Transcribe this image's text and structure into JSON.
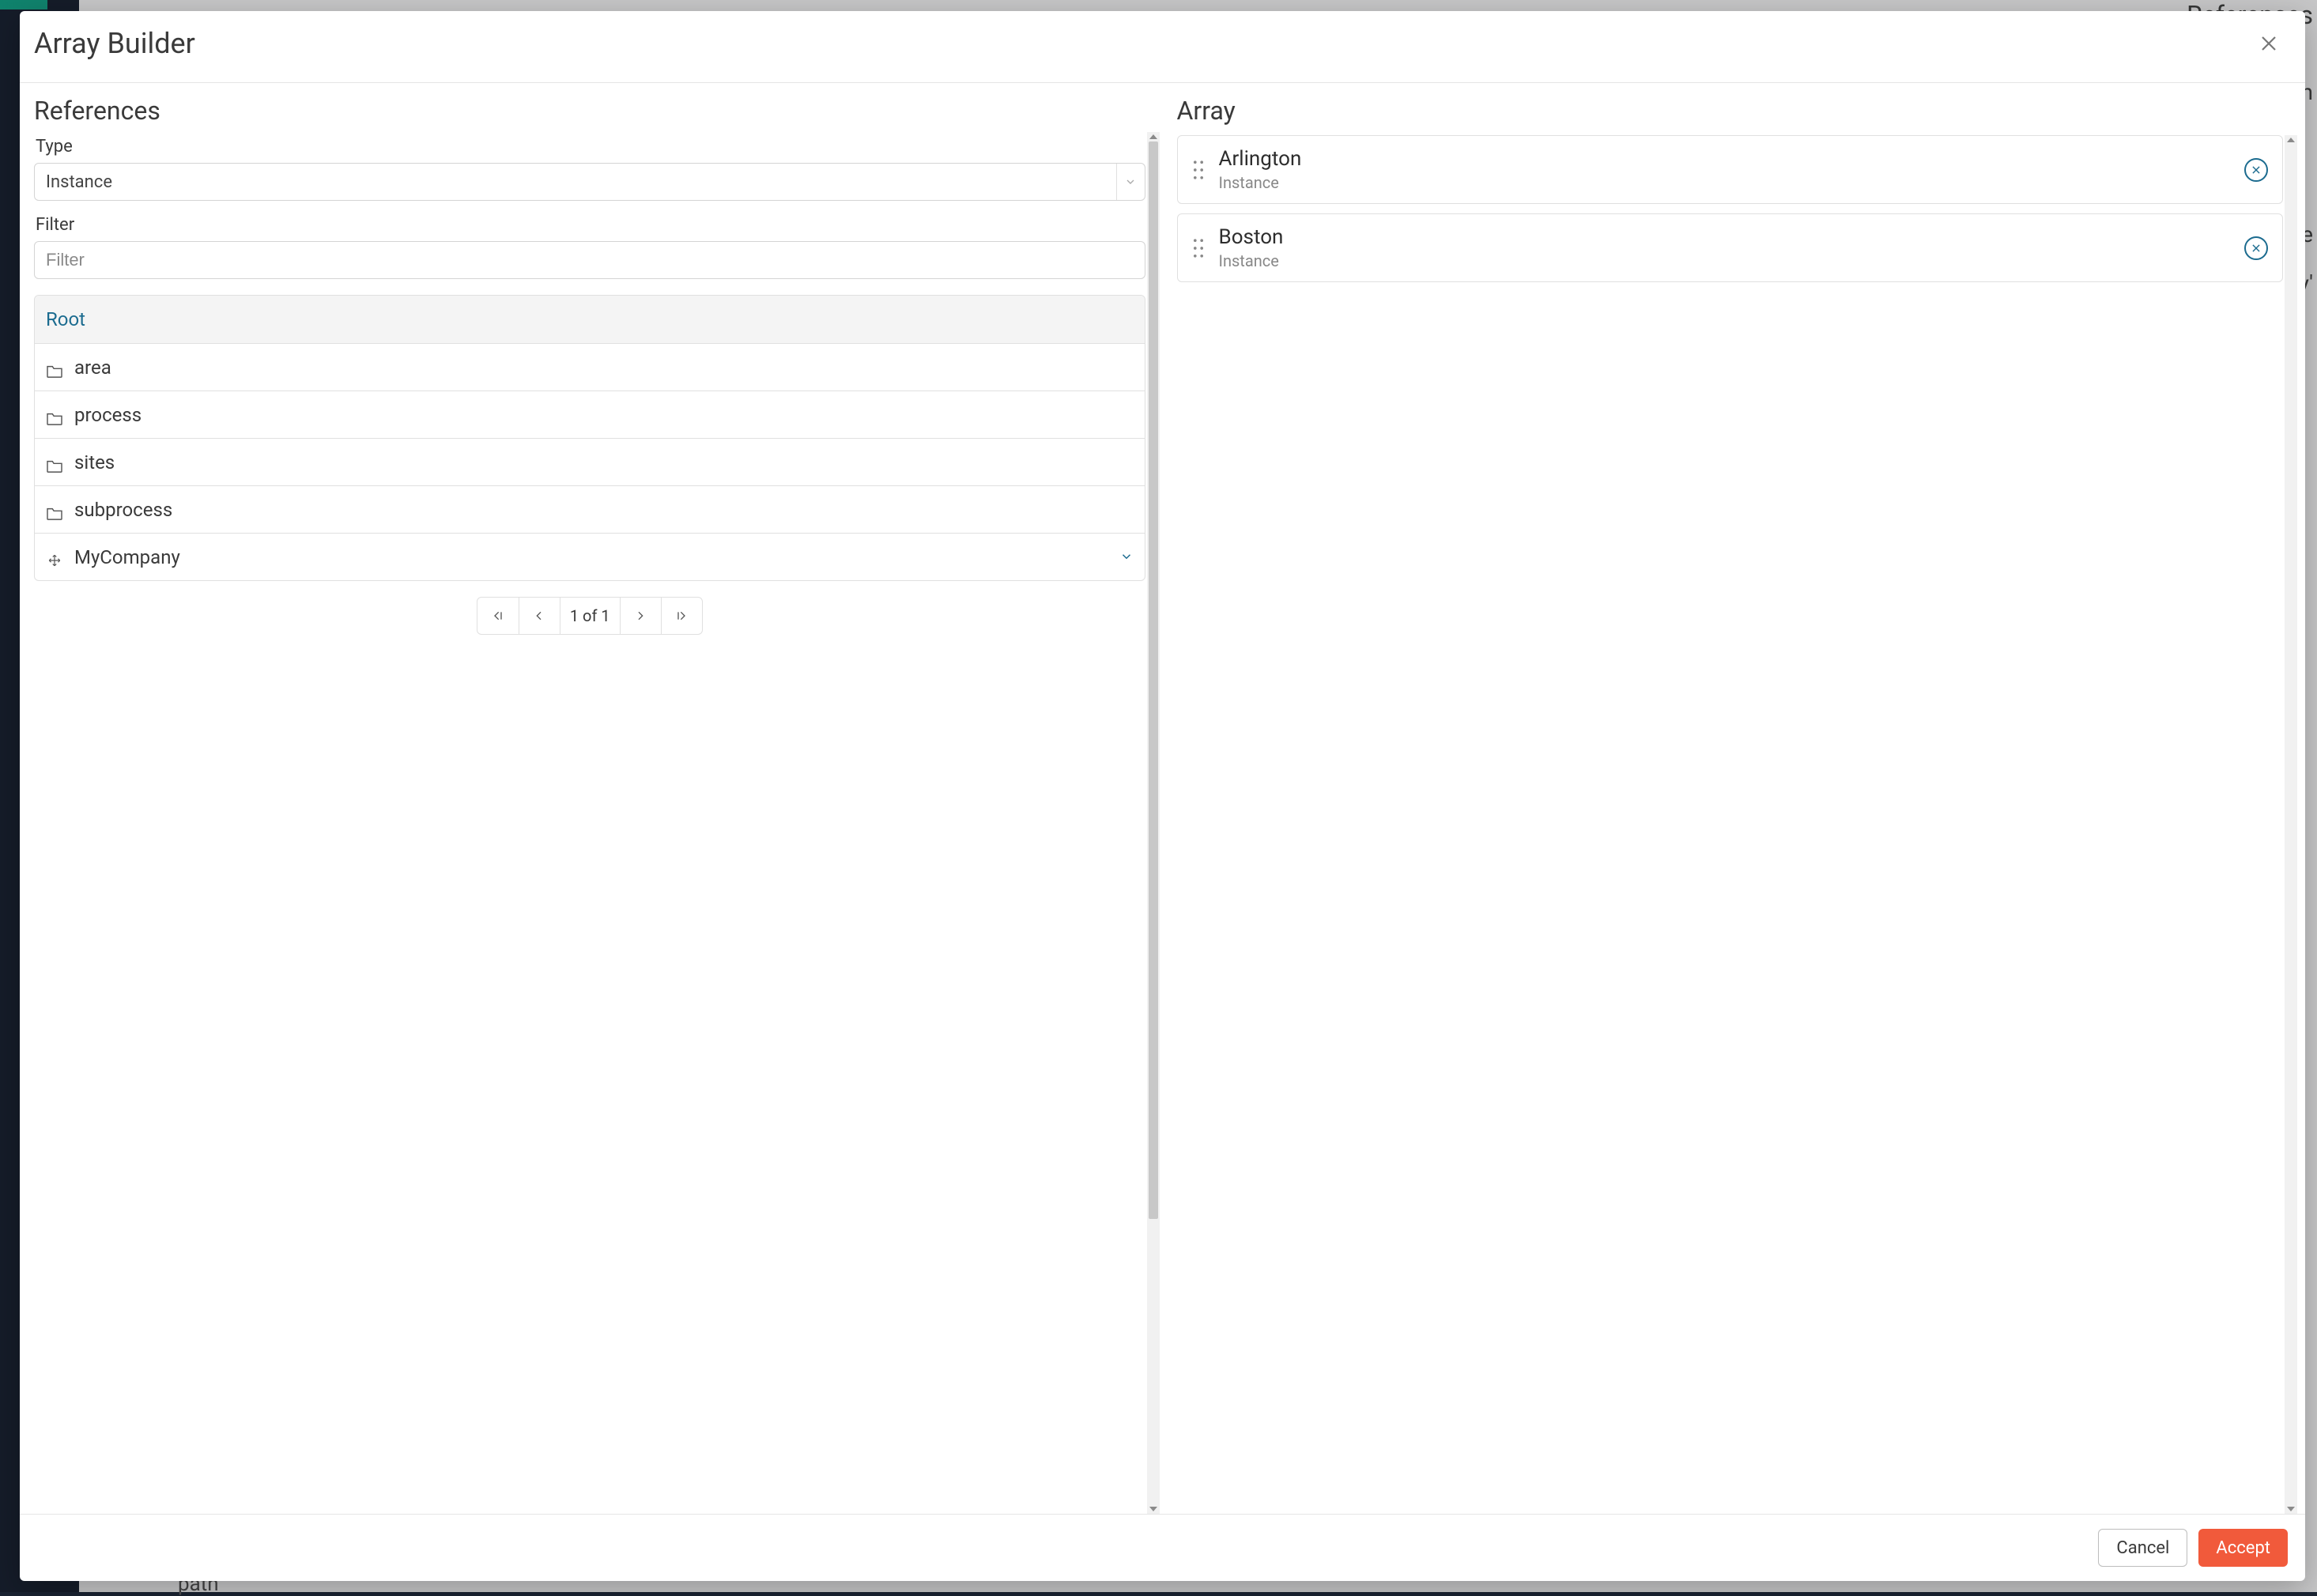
{
  "modal": {
    "title": "Array Builder"
  },
  "references": {
    "title": "References",
    "type_label": "Type",
    "type_value": "Instance",
    "filter_label": "Filter",
    "filter_placeholder": "Filter",
    "root_label": "Root",
    "items": [
      {
        "icon": "folder",
        "label": "area"
      },
      {
        "icon": "folder",
        "label": "process"
      },
      {
        "icon": "folder",
        "label": "sites"
      },
      {
        "icon": "folder",
        "label": "subprocess"
      },
      {
        "icon": "move",
        "label": "MyCompany",
        "expandable": true
      }
    ],
    "pager": {
      "text": "1 of 1"
    }
  },
  "array": {
    "title": "Array",
    "items": [
      {
        "title": "Arlington",
        "subtitle": "Instance"
      },
      {
        "title": "Boston",
        "subtitle": "Instance"
      }
    ]
  },
  "footer": {
    "cancel": "Cancel",
    "accept": "Accept"
  },
  "background": {
    "top_right": "References",
    "path": "path",
    "frag_n": "n",
    "frag_e": "e",
    "frag_ey": "ey'"
  }
}
